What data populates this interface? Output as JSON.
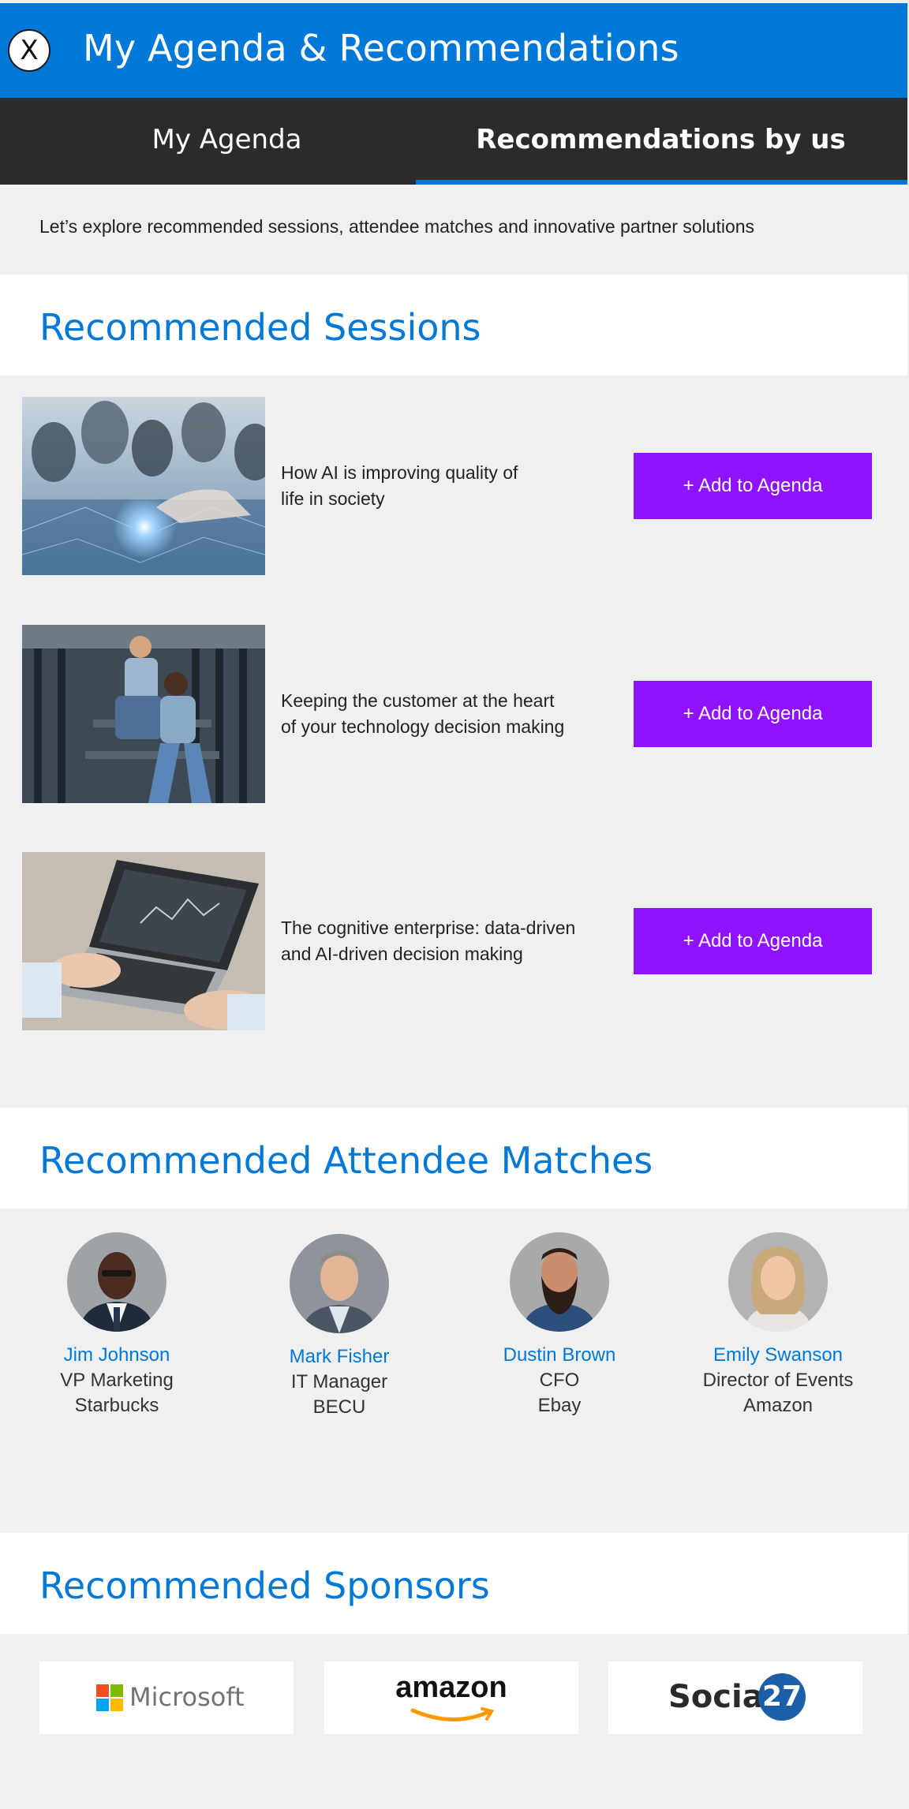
{
  "header": {
    "close_label": "X",
    "title": "My Agenda & Recommendations"
  },
  "tabs": [
    {
      "label": "My Agenda",
      "active": false
    },
    {
      "label": "Recommendations by us",
      "active": true
    }
  ],
  "intro": "Let’s explore recommended sessions, attendee matches and innovative partner solutions",
  "sessions_section": {
    "title": "Recommended Sessions",
    "items": [
      {
        "title_line1": "How AI is improving quality of",
        "title_line2": "life in society",
        "button": "+ Add to Agenda"
      },
      {
        "title_line1": "Keeping the customer at the heart",
        "title_line2": "of your technology decision making",
        "button": "+ Add to Agenda"
      },
      {
        "title_line1": "The cognitive enterprise: data-driven",
        "title_line2": "and AI-driven decision making",
        "button": "+ Add to Agenda"
      }
    ]
  },
  "attendees_section": {
    "title": "Recommended Attendee Matches",
    "items": [
      {
        "name": "Jim Johnson",
        "role": "VP Marketing",
        "company": "Starbucks"
      },
      {
        "name": "Mark Fisher",
        "role": "IT Manager",
        "company": "BECU"
      },
      {
        "name": "Dustin Brown",
        "role": "CFO",
        "company": "Ebay"
      },
      {
        "name": "Emily Swanson",
        "role": "Director of Events",
        "company": "Amazon"
      }
    ]
  },
  "sponsors_section": {
    "title": "Recommended Sponsors",
    "items": [
      {
        "logo_text": "Microsoft"
      },
      {
        "logo_text": "amazon"
      },
      {
        "logo_text": "Social",
        "logo_badge": "27"
      }
    ]
  },
  "colors": {
    "accent": "#0078d7",
    "button": "#9013fe",
    "tab_bar": "#2b2b2b"
  }
}
